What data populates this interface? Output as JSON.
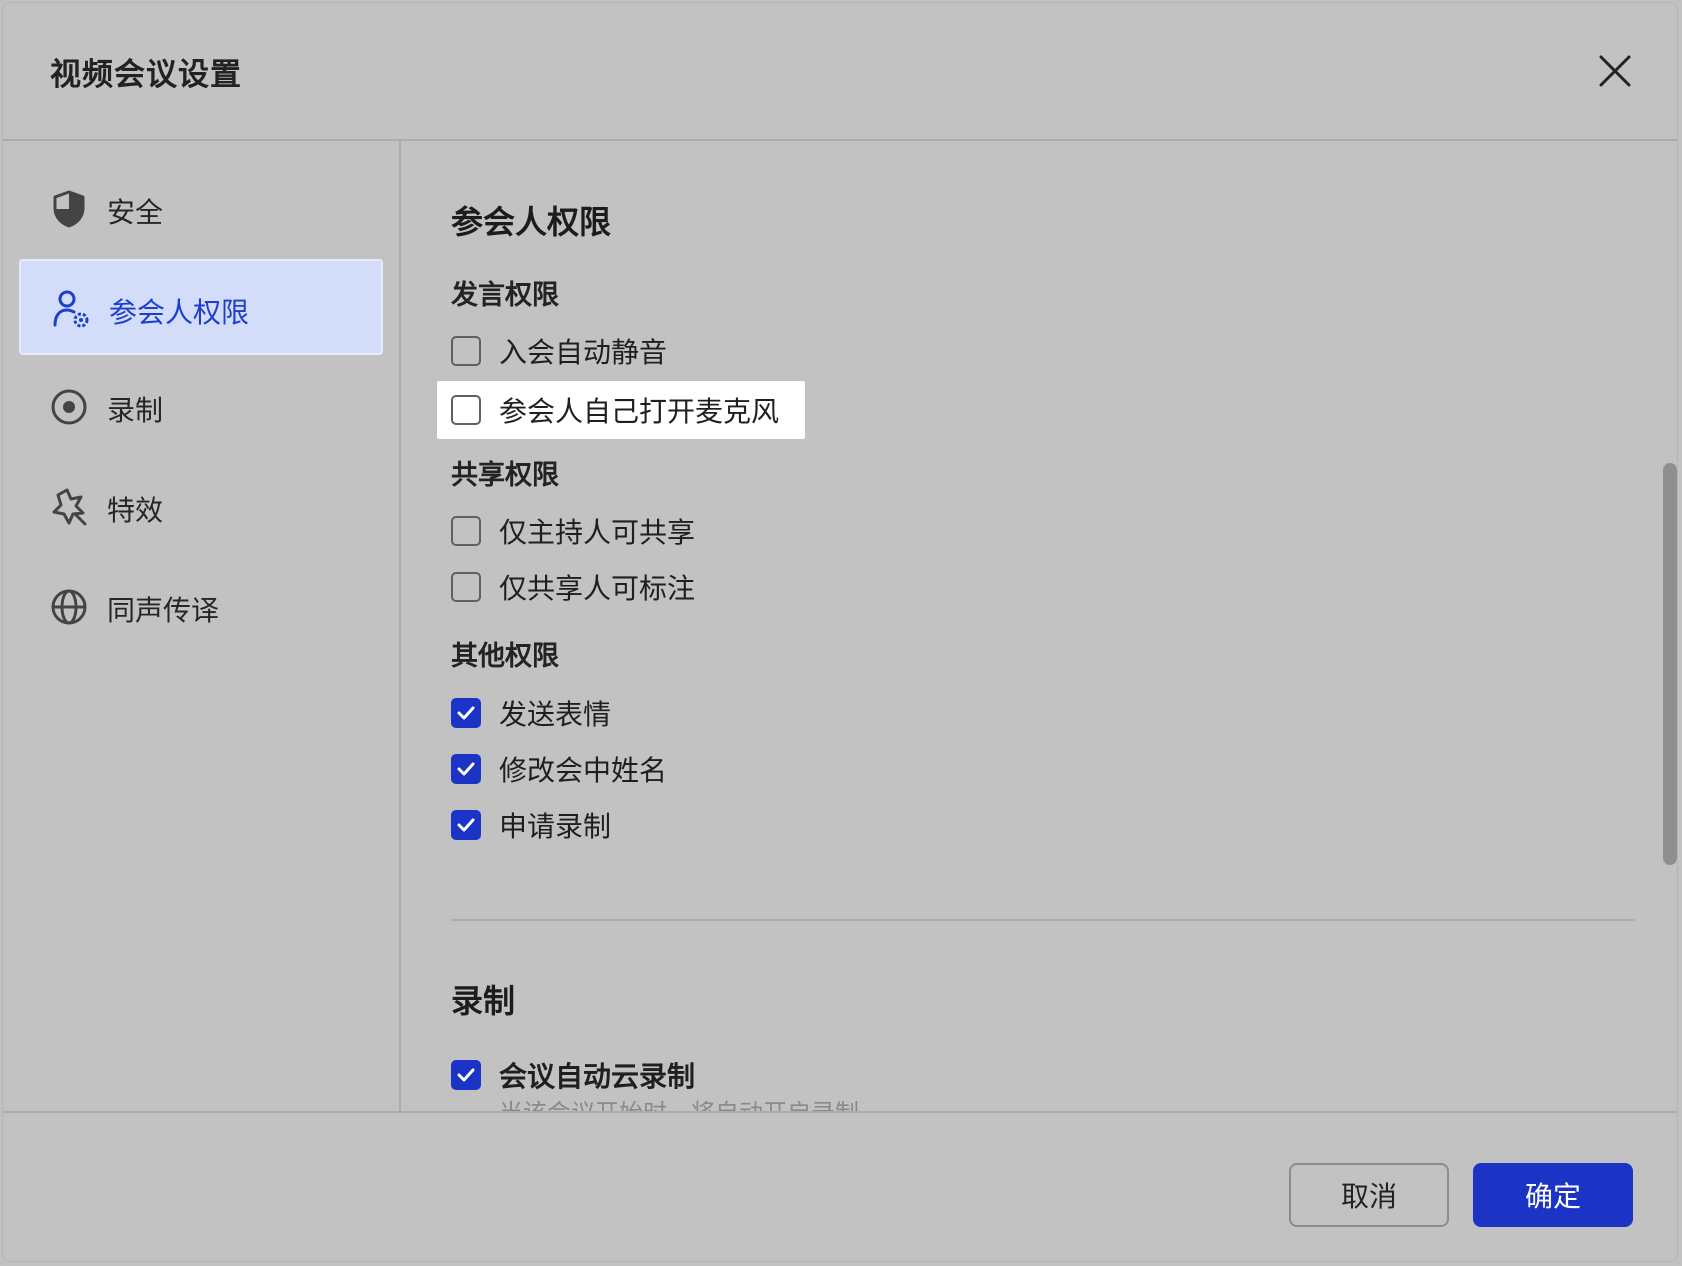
{
  "dialog": {
    "title": "视频会议设置"
  },
  "sidebar": {
    "items": [
      {
        "label": "安全",
        "icon": "shield-icon"
      },
      {
        "label": "参会人权限",
        "icon": "user-gear-icon",
        "active": true
      },
      {
        "label": "录制",
        "icon": "record-icon"
      },
      {
        "label": "特效",
        "icon": "magic-star-icon"
      },
      {
        "label": "同声传译",
        "icon": "globe-icon"
      }
    ]
  },
  "content": {
    "permissions_title": "参会人权限",
    "speak": {
      "title": "发言权限",
      "options": [
        {
          "label": "入会自动静音",
          "checked": false
        },
        {
          "label": "参会人自己打开麦克风",
          "checked": false
        }
      ]
    },
    "share": {
      "title": "共享权限",
      "options": [
        {
          "label": "仅主持人可共享",
          "checked": false
        },
        {
          "label": "仅共享人可标注",
          "checked": false
        }
      ]
    },
    "other": {
      "title": "其他权限",
      "options": [
        {
          "label": "发送表情",
          "checked": true
        },
        {
          "label": "修改会中姓名",
          "checked": true
        },
        {
          "label": "申请录制",
          "checked": true
        }
      ]
    },
    "recording_title": "录制",
    "recording": {
      "option": {
        "label": "会议自动云录制",
        "checked": true
      },
      "description": "当该会议开始时，将自动开启录制"
    }
  },
  "footer": {
    "cancel_label": "取消",
    "confirm_label": "确定"
  },
  "colors": {
    "accent": "#1b34c5",
    "active_bg": "#d3dcf8",
    "background": "#c2c2c2"
  }
}
